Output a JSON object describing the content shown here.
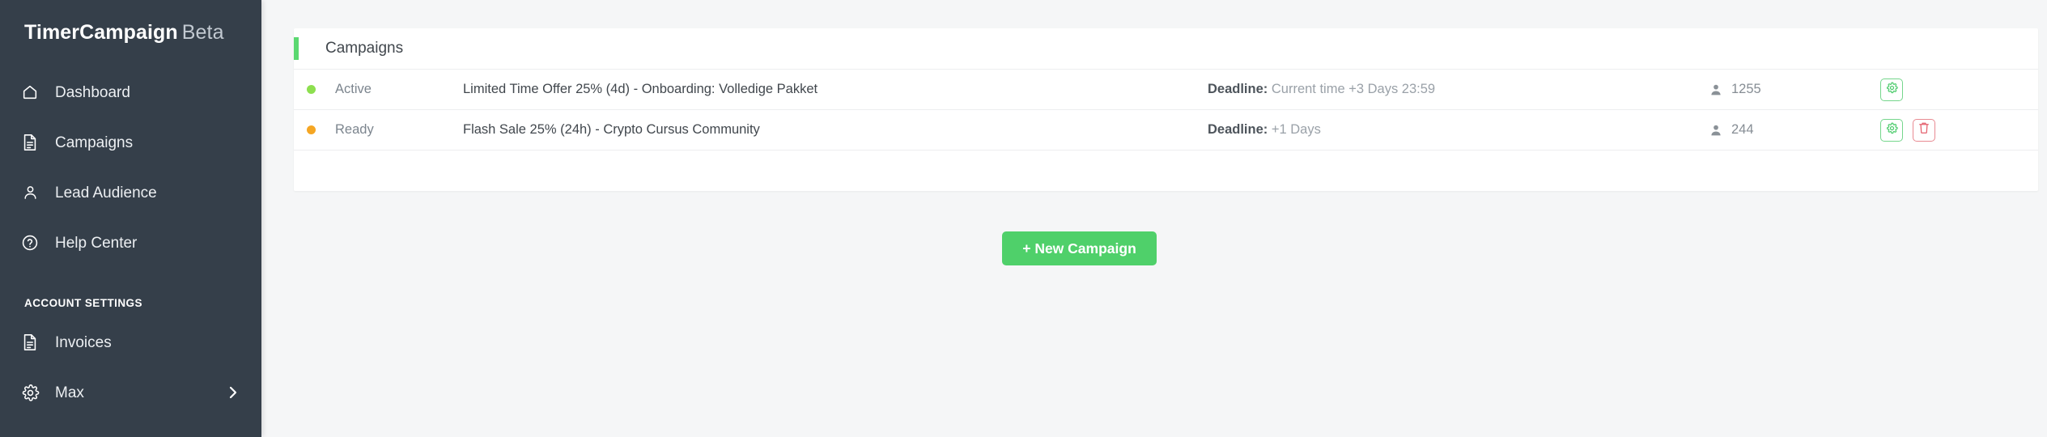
{
  "sidebar": {
    "brand": {
      "name": "TimerCampaign",
      "suffix": "Beta"
    },
    "items": [
      {
        "label": "Dashboard",
        "icon": "home-icon"
      },
      {
        "label": "Campaigns",
        "icon": "document-icon"
      },
      {
        "label": "Lead Audience",
        "icon": "user-icon"
      },
      {
        "label": "Help Center",
        "icon": "question-circle-icon"
      }
    ],
    "section_title": "ACCOUNT SETTINGS",
    "account_items": [
      {
        "label": "Invoices",
        "icon": "document-icon",
        "chevron": false
      },
      {
        "label": "Max",
        "icon": "gear-icon",
        "chevron": true
      }
    ],
    "bg_color": "#353f4a"
  },
  "card": {
    "title": "Campaigns",
    "accent_color": "#5ad870",
    "rows": [
      {
        "status": "Active",
        "status_color": "#8ddf4f",
        "name": "Limited Time Offer 25% (4d) - Onboarding: Volledige Pakket",
        "deadline_label": "Deadline:",
        "deadline_value": "Current time +3 Days 23:59",
        "count": "1255",
        "actions": [
          {
            "icon": "gear-icon",
            "variant": "green"
          }
        ]
      },
      {
        "status": "Ready",
        "status_color": "#f5a623",
        "name": "Flash Sale 25% (24h) - Crypto Cursus Community",
        "deadline_label": "Deadline:",
        "deadline_value": "+1 Days",
        "count": "244",
        "actions": [
          {
            "icon": "gear-icon",
            "variant": "green"
          },
          {
            "icon": "trash-icon",
            "variant": "red"
          }
        ]
      }
    ]
  },
  "cta": {
    "label": "+ New Campaign",
    "color": "#4fd06a"
  }
}
